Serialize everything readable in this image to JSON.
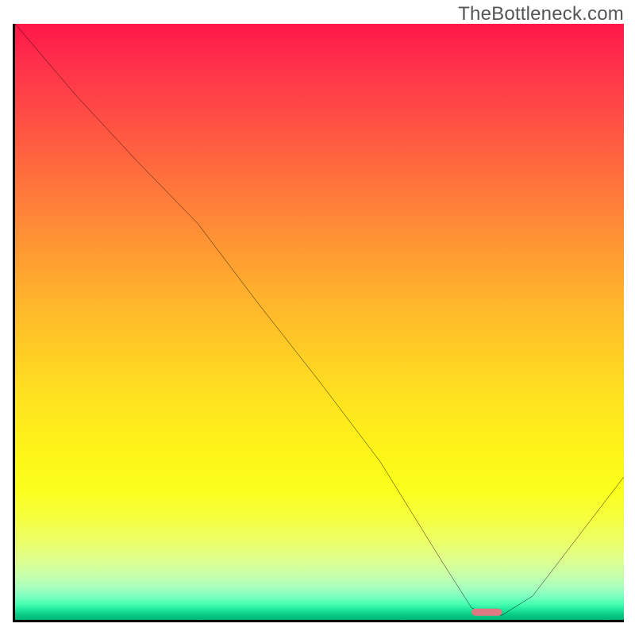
{
  "watermark": "TheBottleneck.com",
  "chart_data": {
    "type": "line",
    "title": "",
    "xlabel": "",
    "ylabel": "",
    "xlim": [
      0,
      100
    ],
    "ylim": [
      0,
      100
    ],
    "series": [
      {
        "name": "curve",
        "x": [
          0,
          10,
          20,
          30,
          40,
          50,
          60,
          70,
          75,
          78,
          80,
          85,
          100
        ],
        "y": [
          100,
          88,
          77,
          66.5,
          53,
          40,
          26.5,
          10,
          2,
          0.8,
          0.8,
          4,
          24
        ]
      }
    ],
    "marker": {
      "x_start": 75,
      "x_end": 80,
      "y": 1.3,
      "color": "#e07a82"
    },
    "gradient_stops": [
      {
        "pos": 0,
        "color": "#ff1749"
      },
      {
        "pos": 50,
        "color": "#ffc024"
      },
      {
        "pos": 80,
        "color": "#fbff1c"
      },
      {
        "pos": 100,
        "color": "#00b173"
      }
    ]
  }
}
